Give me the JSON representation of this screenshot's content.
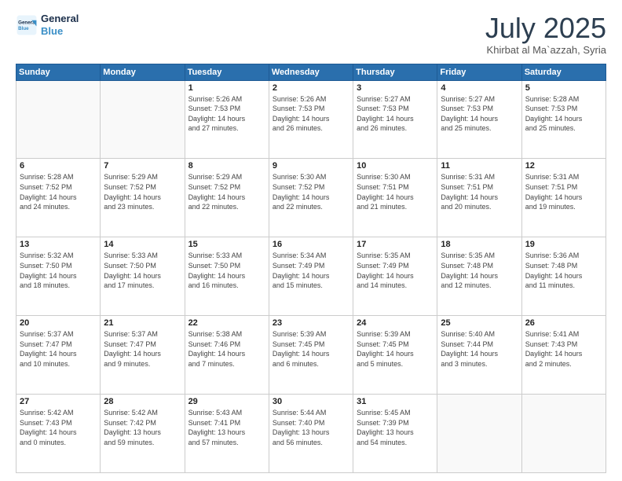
{
  "logo": {
    "line1": "General",
    "line2": "Blue"
  },
  "title": "July 2025",
  "subtitle": "Khirbat al Ma`azzah, Syria",
  "weekdays": [
    "Sunday",
    "Monday",
    "Tuesday",
    "Wednesday",
    "Thursday",
    "Friday",
    "Saturday"
  ],
  "weeks": [
    [
      {
        "day": "",
        "info": ""
      },
      {
        "day": "",
        "info": ""
      },
      {
        "day": "1",
        "info": "Sunrise: 5:26 AM\nSunset: 7:53 PM\nDaylight: 14 hours\nand 27 minutes."
      },
      {
        "day": "2",
        "info": "Sunrise: 5:26 AM\nSunset: 7:53 PM\nDaylight: 14 hours\nand 26 minutes."
      },
      {
        "day": "3",
        "info": "Sunrise: 5:27 AM\nSunset: 7:53 PM\nDaylight: 14 hours\nand 26 minutes."
      },
      {
        "day": "4",
        "info": "Sunrise: 5:27 AM\nSunset: 7:53 PM\nDaylight: 14 hours\nand 25 minutes."
      },
      {
        "day": "5",
        "info": "Sunrise: 5:28 AM\nSunset: 7:53 PM\nDaylight: 14 hours\nand 25 minutes."
      }
    ],
    [
      {
        "day": "6",
        "info": "Sunrise: 5:28 AM\nSunset: 7:52 PM\nDaylight: 14 hours\nand 24 minutes."
      },
      {
        "day": "7",
        "info": "Sunrise: 5:29 AM\nSunset: 7:52 PM\nDaylight: 14 hours\nand 23 minutes."
      },
      {
        "day": "8",
        "info": "Sunrise: 5:29 AM\nSunset: 7:52 PM\nDaylight: 14 hours\nand 22 minutes."
      },
      {
        "day": "9",
        "info": "Sunrise: 5:30 AM\nSunset: 7:52 PM\nDaylight: 14 hours\nand 22 minutes."
      },
      {
        "day": "10",
        "info": "Sunrise: 5:30 AM\nSunset: 7:51 PM\nDaylight: 14 hours\nand 21 minutes."
      },
      {
        "day": "11",
        "info": "Sunrise: 5:31 AM\nSunset: 7:51 PM\nDaylight: 14 hours\nand 20 minutes."
      },
      {
        "day": "12",
        "info": "Sunrise: 5:31 AM\nSunset: 7:51 PM\nDaylight: 14 hours\nand 19 minutes."
      }
    ],
    [
      {
        "day": "13",
        "info": "Sunrise: 5:32 AM\nSunset: 7:50 PM\nDaylight: 14 hours\nand 18 minutes."
      },
      {
        "day": "14",
        "info": "Sunrise: 5:33 AM\nSunset: 7:50 PM\nDaylight: 14 hours\nand 17 minutes."
      },
      {
        "day": "15",
        "info": "Sunrise: 5:33 AM\nSunset: 7:50 PM\nDaylight: 14 hours\nand 16 minutes."
      },
      {
        "day": "16",
        "info": "Sunrise: 5:34 AM\nSunset: 7:49 PM\nDaylight: 14 hours\nand 15 minutes."
      },
      {
        "day": "17",
        "info": "Sunrise: 5:35 AM\nSunset: 7:49 PM\nDaylight: 14 hours\nand 14 minutes."
      },
      {
        "day": "18",
        "info": "Sunrise: 5:35 AM\nSunset: 7:48 PM\nDaylight: 14 hours\nand 12 minutes."
      },
      {
        "day": "19",
        "info": "Sunrise: 5:36 AM\nSunset: 7:48 PM\nDaylight: 14 hours\nand 11 minutes."
      }
    ],
    [
      {
        "day": "20",
        "info": "Sunrise: 5:37 AM\nSunset: 7:47 PM\nDaylight: 14 hours\nand 10 minutes."
      },
      {
        "day": "21",
        "info": "Sunrise: 5:37 AM\nSunset: 7:47 PM\nDaylight: 14 hours\nand 9 minutes."
      },
      {
        "day": "22",
        "info": "Sunrise: 5:38 AM\nSunset: 7:46 PM\nDaylight: 14 hours\nand 7 minutes."
      },
      {
        "day": "23",
        "info": "Sunrise: 5:39 AM\nSunset: 7:45 PM\nDaylight: 14 hours\nand 6 minutes."
      },
      {
        "day": "24",
        "info": "Sunrise: 5:39 AM\nSunset: 7:45 PM\nDaylight: 14 hours\nand 5 minutes."
      },
      {
        "day": "25",
        "info": "Sunrise: 5:40 AM\nSunset: 7:44 PM\nDaylight: 14 hours\nand 3 minutes."
      },
      {
        "day": "26",
        "info": "Sunrise: 5:41 AM\nSunset: 7:43 PM\nDaylight: 14 hours\nand 2 minutes."
      }
    ],
    [
      {
        "day": "27",
        "info": "Sunrise: 5:42 AM\nSunset: 7:43 PM\nDaylight: 14 hours\nand 0 minutes."
      },
      {
        "day": "28",
        "info": "Sunrise: 5:42 AM\nSunset: 7:42 PM\nDaylight: 13 hours\nand 59 minutes."
      },
      {
        "day": "29",
        "info": "Sunrise: 5:43 AM\nSunset: 7:41 PM\nDaylight: 13 hours\nand 57 minutes."
      },
      {
        "day": "30",
        "info": "Sunrise: 5:44 AM\nSunset: 7:40 PM\nDaylight: 13 hours\nand 56 minutes."
      },
      {
        "day": "31",
        "info": "Sunrise: 5:45 AM\nSunset: 7:39 PM\nDaylight: 13 hours\nand 54 minutes."
      },
      {
        "day": "",
        "info": ""
      },
      {
        "day": "",
        "info": ""
      }
    ]
  ]
}
